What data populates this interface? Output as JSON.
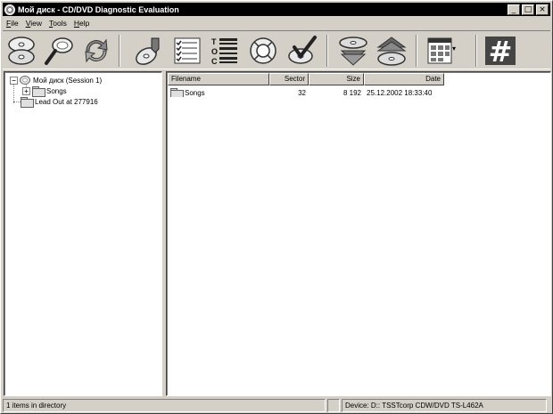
{
  "window": {
    "title": "Мой диск - CD/DVD Diagnostic Evaluation",
    "minimize_glyph": "_",
    "maximize_glyph": "□",
    "close_glyph": "×"
  },
  "menu": {
    "items": [
      {
        "accel": "F",
        "rest": "ile"
      },
      {
        "accel": "V",
        "rest": "iew"
      },
      {
        "accel": "T",
        "rest": "ools"
      },
      {
        "accel": "H",
        "rest": "elp"
      }
    ]
  },
  "toolbar": {
    "icons": [
      "scan-disc-icon",
      "search-icon",
      "refresh-icon",
      "extract-icon",
      "checklist-icon",
      "toc-icon",
      "lifebuoy-icon",
      "verify-icon",
      "disc-stack-down-icon",
      "disc-stack-up-icon",
      "view-options-icon",
      "hash-icon"
    ],
    "toc_letters": [
      "T",
      "O",
      "C"
    ],
    "hash_glyph": "#",
    "dropdown_glyph": "▾"
  },
  "tree": {
    "collapse_glyph": "−",
    "expand_glyph": "+",
    "session": "Мой диск (Session 1)",
    "folder": "Songs",
    "leadout": "Lead Out at 277916"
  },
  "list": {
    "columns": {
      "filename": "Filename",
      "sector": "Sector",
      "size": "Size",
      "date": "Date"
    },
    "rows": [
      {
        "filename": "Songs",
        "sector": "32",
        "size": "8 192",
        "date": "25.12.2002 18:33:40"
      }
    ]
  },
  "status": {
    "items_text": "1 items in directory",
    "device_text": "Device: D:: TSSTcorp CDW/DVD TS-L462A"
  }
}
